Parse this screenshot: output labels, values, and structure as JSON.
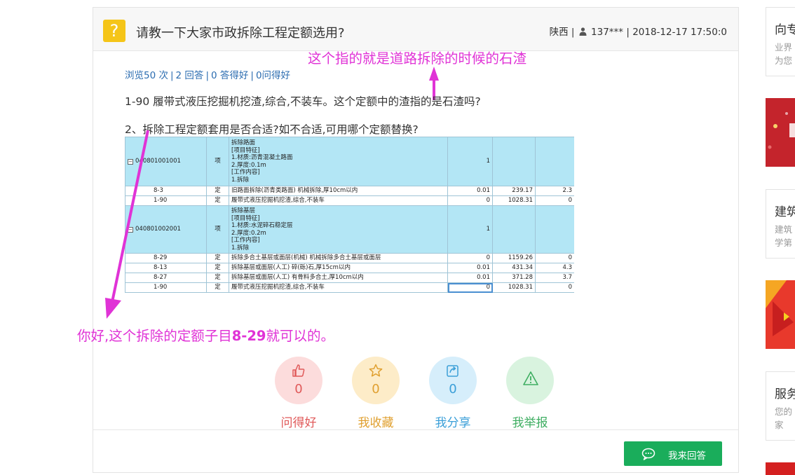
{
  "question": {
    "icon": "question-mark-icon",
    "icon_glyph": "?",
    "title": "请教一下大家市政拆除工程定额选用?",
    "region": "陕西",
    "user": "137***",
    "time": "2018-12-17 17:50:0",
    "stats": {
      "views": "浏览50 次",
      "answers": "2 回答",
      "good_answers": "0 答得好",
      "good_questions": "0问得好"
    },
    "paragraph1": "1-90 履带式液压挖掘机挖渣,综合,不装车。这个定额中的渣指的是石渣吗?",
    "paragraph2": "2、拆除工程定额套用是否合适?如不合适,可用哪个定额替换?"
  },
  "annotations": {
    "top": "这个指的就是道路拆除的时候的石渣",
    "bottom_prefix": "你好,这个拆除的定额子目",
    "bottom_code": "8-29",
    "bottom_suffix": "就可以的。",
    "color": "#e033d6"
  },
  "sheet": {
    "group1": {
      "code": "040801001001",
      "unit": "项",
      "desc": [
        "拆除路面",
        "[项目特征]",
        "1.材质:沥青混凝土路面",
        "2.厚度:0.1m",
        "[工作内容]",
        "1.拆除"
      ],
      "qty": "1",
      "rows": [
        {
          "code": "8-3",
          "unit": "定",
          "desc": "旧路面拆除(沥青类路面) 机械拆除,厚10cm以内",
          "qty": "0.01",
          "price": "239.17",
          "total": "2.3"
        },
        {
          "code": "1-90",
          "unit": "定",
          "desc": "履带式液压挖掘机挖渣,综合,不装车",
          "qty": "0",
          "price": "1028.31",
          "total": "0"
        }
      ]
    },
    "group2": {
      "code": "040801002001",
      "unit": "项",
      "desc": [
        "拆除基层",
        "[项目特征]",
        "1.材质:水泥碎石稳定层",
        "2.厚度:0.2m",
        "[工作内容]",
        "1.拆除"
      ],
      "qty": "1",
      "rows": [
        {
          "code": "8-29",
          "unit": "定",
          "desc": "拆除多合土基层或面层(机械) 机械拆除多合土基层或面层",
          "qty": "0",
          "price": "1159.26",
          "total": "0"
        },
        {
          "code": "8-13",
          "unit": "定",
          "desc": "拆除基层或面层(人工) 碎(砾)石,厚15cm以内",
          "qty": "0.01",
          "price": "431.34",
          "total": "4.3"
        },
        {
          "code": "8-27",
          "unit": "定",
          "desc": "拆除基层或面层(人工) 有骨料多合土,厚10cm以内",
          "qty": "0.01",
          "price": "371.28",
          "total": "3.7"
        },
        {
          "code": "1-90",
          "unit": "定",
          "desc": "履带式液压挖掘机挖渣,综合,不装车",
          "qty": "0",
          "price": "1028.31",
          "total": "0"
        }
      ]
    }
  },
  "actions": [
    {
      "name": "like",
      "icon": "thumbs-up-icon",
      "count": "0",
      "label": "问得好",
      "color": "#e05a5a",
      "bg": "#fcdcdc"
    },
    {
      "name": "favorite",
      "icon": "star-icon",
      "count": "0",
      "label": "我收藏",
      "color": "#e0a030",
      "bg": "#fdecc8"
    },
    {
      "name": "share",
      "icon": "share-icon",
      "count": "0",
      "label": "我分享",
      "color": "#3b9fd8",
      "bg": "#d6eefb"
    },
    {
      "name": "report",
      "icon": "warning-icon",
      "count": "",
      "label": "我举报",
      "color": "#3fae62",
      "bg": "#d9f3df"
    }
  ],
  "answer_button": {
    "label": "我来回答",
    "icon": "chat-bubble-icon",
    "color": "#1aad5b"
  },
  "sidebar": {
    "cards": [
      {
        "title": "向专",
        "lines": [
          "业界",
          "为您"
        ]
      },
      {
        "title": "建筑",
        "lines": [
          "建筑",
          "学第"
        ]
      },
      {
        "title": "服务",
        "lines": [
          "您的",
          "家"
        ]
      }
    ]
  }
}
